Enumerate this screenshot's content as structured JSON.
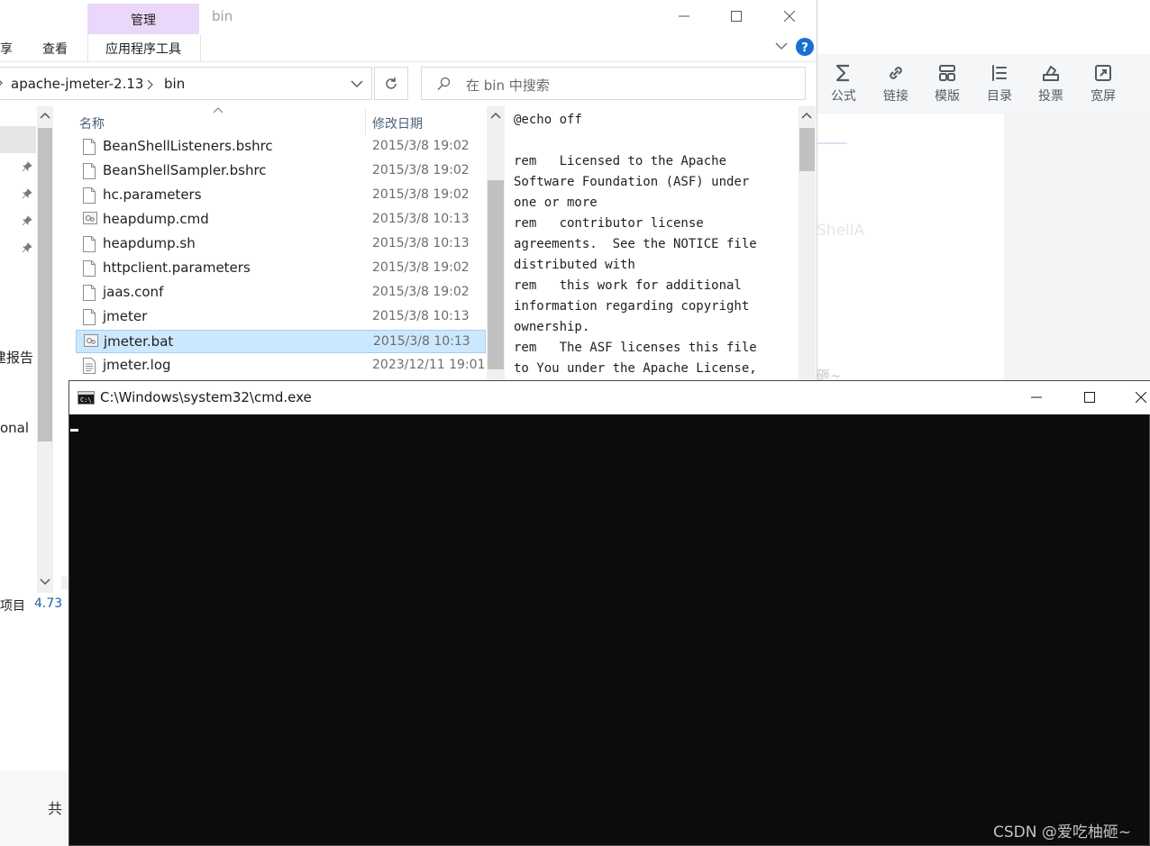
{
  "editor": {
    "tools": [
      {
        "icon": "sigma-icon",
        "label": "公式"
      },
      {
        "icon": "link-icon",
        "label": "链接"
      },
      {
        "icon": "template-icon",
        "label": "模版"
      },
      {
        "icon": "list-icon",
        "label": "目录"
      },
      {
        "icon": "vote-icon",
        "label": "投票"
      },
      {
        "icon": "expand-icon",
        "label": "宽屏"
      }
    ],
    "ghost_text": "ShellA",
    "ghost_bottom": "砸~"
  },
  "explorer": {
    "window_title": "bin",
    "ribbon": {
      "share_partial": "享",
      "view": "查看",
      "manage_tab": "管理",
      "app_tools": "应用程序工具"
    },
    "breadcrumb": [
      "apache-jmeter-2.13",
      "bin"
    ],
    "search_placeholder": "在 bin 中搜索",
    "columns": {
      "name": "名称",
      "date": "修改日期"
    },
    "files": [
      {
        "name": "BeanShellListeners.bshrc",
        "date": "2015/3/8 19:02",
        "icon": "document-icon",
        "selected": false
      },
      {
        "name": "BeanShellSampler.bshrc",
        "date": "2015/3/8 19:02",
        "icon": "document-icon",
        "selected": false
      },
      {
        "name": "hc.parameters",
        "date": "2015/3/8 19:02",
        "icon": "document-icon",
        "selected": false
      },
      {
        "name": "heapdump.cmd",
        "date": "2015/3/8 10:13",
        "icon": "batch-file-icon",
        "selected": false
      },
      {
        "name": "heapdump.sh",
        "date": "2015/3/8 10:13",
        "icon": "document-icon",
        "selected": false
      },
      {
        "name": "httpclient.parameters",
        "date": "2015/3/8 19:02",
        "icon": "document-icon",
        "selected": false
      },
      {
        "name": "jaas.conf",
        "date": "2015/3/8 19:02",
        "icon": "document-icon",
        "selected": false
      },
      {
        "name": "jmeter",
        "date": "2015/3/8 10:13",
        "icon": "document-icon",
        "selected": false
      },
      {
        "name": "jmeter.bat",
        "date": "2015/3/8 10:13",
        "icon": "batch-file-icon",
        "selected": true
      },
      {
        "name": "jmeter.log",
        "date": "2023/12/11 19:01",
        "icon": "text-file-icon",
        "selected": false
      }
    ],
    "preview_lines": [
      "@echo off",
      "",
      "rem   Licensed to the Apache",
      "Software Foundation (ASF) under",
      "one or more",
      "rem   contributor license",
      "agreements.  See the NOTICE file",
      "distributed with",
      "rem   this work for additional",
      "information regarding copyright",
      "ownership.",
      "rem   The ASF licenses this file",
      "to You under the Apache License,"
    ],
    "nav_labels": {
      "report_partial": "建报告",
      "onal_partial": "onal"
    },
    "status": {
      "items_partial": "项目",
      "size_partial": "4.73"
    },
    "left_lower_char": "共"
  },
  "cmd": {
    "title": "C:\\Windows\\system32\\cmd.exe"
  },
  "watermark": "CSDN @爱吃柚砸~"
}
